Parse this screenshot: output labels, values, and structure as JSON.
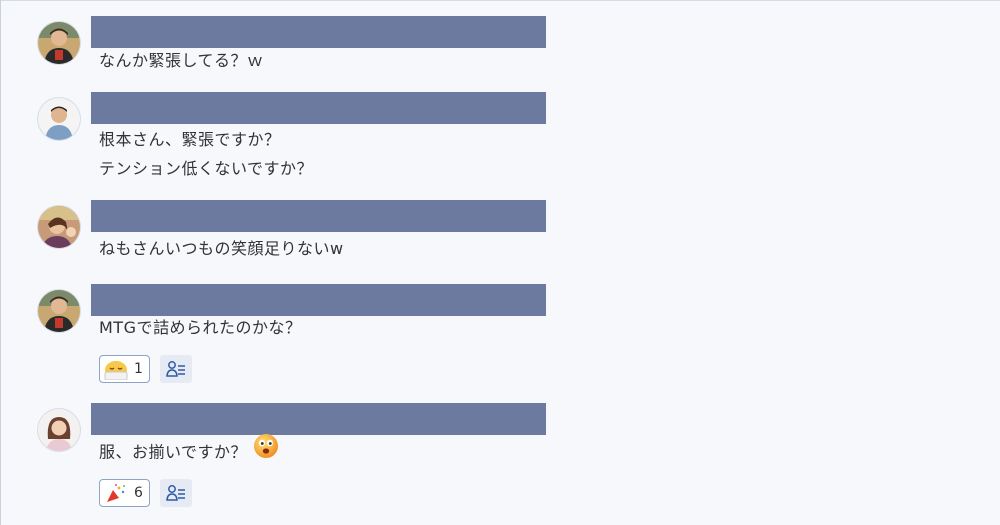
{
  "messages": [
    {
      "id": "m1",
      "lines": [
        "なんか緊張してる？ｗ"
      ]
    },
    {
      "id": "m2",
      "lines": [
        "根本さん、緊張ですか？",
        "テンション低くないですか？"
      ]
    },
    {
      "id": "m3",
      "lines": [
        "ねもさんいつもの笑顔足りないw"
      ]
    },
    {
      "id": "m4",
      "lines": [
        "MTGで詰められたのかな？"
      ],
      "reactions": [
        {
          "icon": "sleepy-face-emoji",
          "count": "1"
        }
      ]
    },
    {
      "id": "m5",
      "lines": [
        "服、お揃いですか？"
      ],
      "inline_emoji": "surprised-face-emoji",
      "reactions": [
        {
          "icon": "party-popper-emoji",
          "count": "6"
        }
      ]
    }
  ],
  "colors": {
    "background": "#f6f8fc",
    "name_bar": "#6b7a9e",
    "reaction_border": "#8da3c7",
    "reactor_button": "#e6eaf2",
    "reactor_icon": "#2f5aa8"
  }
}
